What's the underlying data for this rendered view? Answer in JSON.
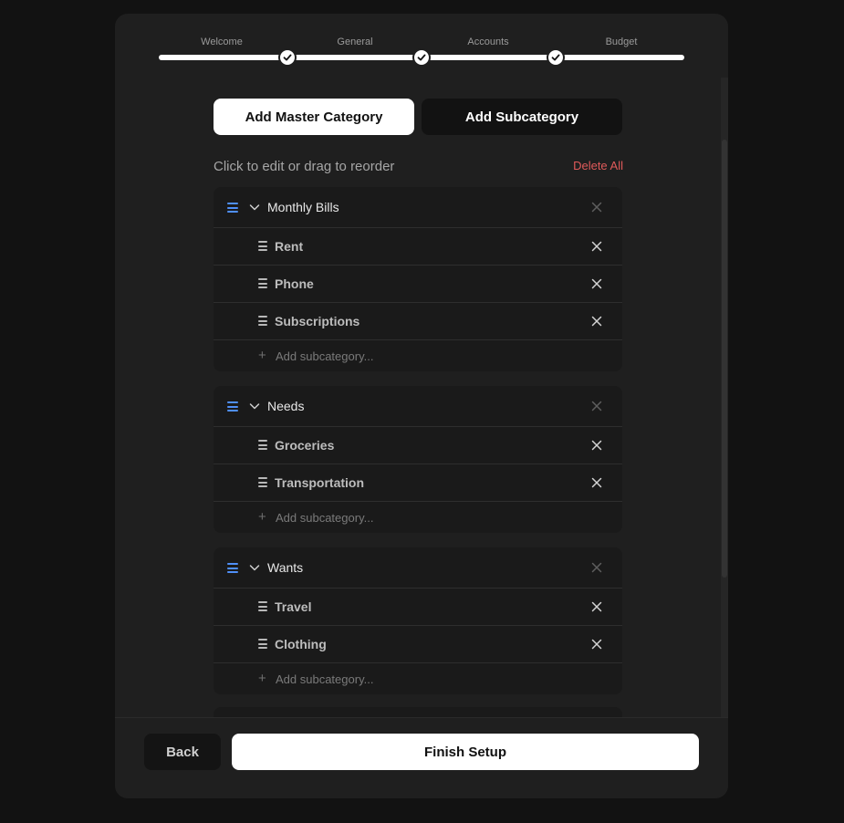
{
  "stepper": {
    "steps": [
      {
        "label": "Welcome"
      },
      {
        "label": "General"
      },
      {
        "label": "Accounts"
      },
      {
        "label": "Budget"
      }
    ],
    "completed_icon": "check-icon"
  },
  "tabs": {
    "master_label": "Add Master Category",
    "sub_label": "Add Subcategory"
  },
  "list": {
    "hint": "Click to edit or drag to reorder",
    "delete_all": "Delete All"
  },
  "categories": [
    {
      "name": "Monthly Bills",
      "subcategories": [
        "Rent",
        "Phone",
        "Subscriptions"
      ],
      "add_placeholder": "Add subcategory..."
    },
    {
      "name": "Needs",
      "subcategories": [
        "Groceries",
        "Transportation"
      ],
      "add_placeholder": "Add subcategory..."
    },
    {
      "name": "Wants",
      "subcategories": [
        "Travel",
        "Clothing"
      ],
      "add_placeholder": "Add subcategory..."
    }
  ],
  "footer": {
    "back_label": "Back",
    "finish_label": "Finish Setup"
  },
  "colors": {
    "background": "#121212",
    "panel": "#1f1f1f",
    "accent_handle": "#4f8ff7",
    "danger": "#e05a5a",
    "primary_button": "#ffffff"
  },
  "icons": {
    "handle": "drag-handle-icon",
    "chevron": "chevron-down-icon",
    "remove": "close-icon",
    "add": "plus-icon"
  }
}
